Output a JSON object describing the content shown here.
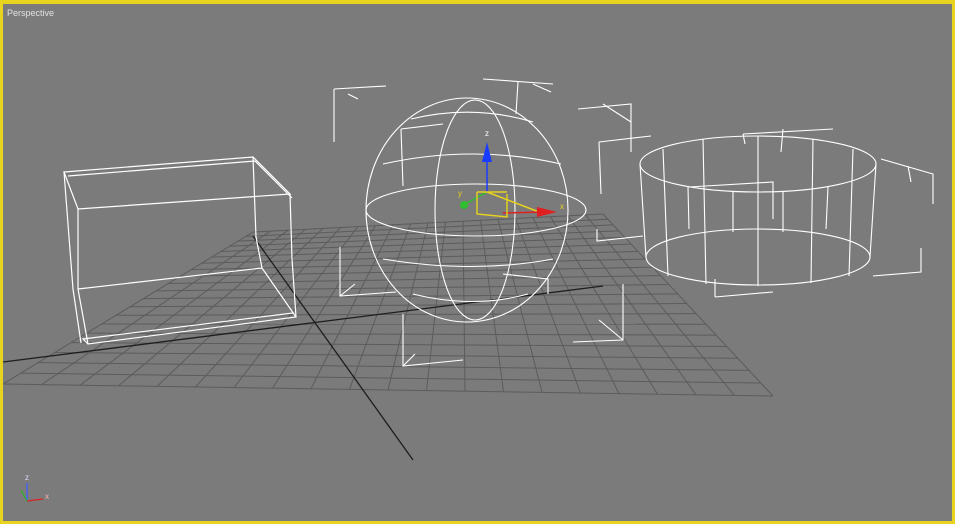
{
  "viewport": {
    "label": "Perspective",
    "border_color": "#e8d31e",
    "background_color": "#7b7b7b"
  },
  "grid": {
    "line_color": "#5c5c5c",
    "axis_color": "#1e1e1e"
  },
  "objects": [
    {
      "name": "Box",
      "color": "#ffffff"
    },
    {
      "name": "Sphere",
      "color": "#ffffff",
      "selected": true
    },
    {
      "name": "Cylinder",
      "color": "#ffffff"
    }
  ],
  "transform_gizmo": {
    "x_label": "x",
    "y_label": "y",
    "z_label": "z",
    "x_color": "#e02020",
    "y_color": "#2fbf2f",
    "z_color": "#1a3cff"
  },
  "axis_tripod": {
    "x_label": "x",
    "y_label": "y",
    "z_label": "z"
  }
}
